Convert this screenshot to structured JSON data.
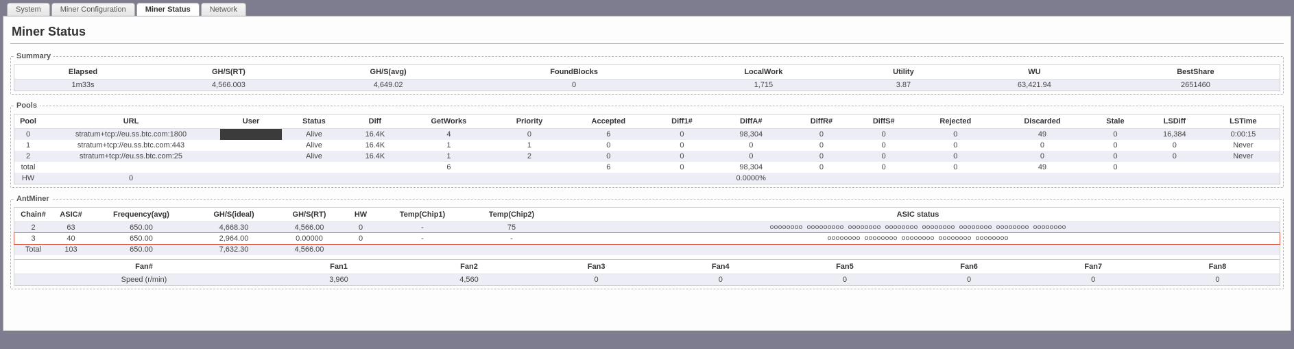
{
  "tabs": {
    "system": "System",
    "miner_config": "Miner Configuration",
    "miner_status": "Miner Status",
    "network": "Network"
  },
  "page_title": "Miner Status",
  "summary": {
    "legend": "Summary",
    "headers": {
      "elapsed": "Elapsed",
      "ghs_rt": "GH/S(RT)",
      "ghs_avg": "GH/S(avg)",
      "found_blocks": "FoundBlocks",
      "local_work": "LocalWork",
      "utility": "Utility",
      "wu": "WU",
      "best_share": "BestShare"
    },
    "row": {
      "elapsed": "1m33s",
      "ghs_rt": "4,566.003",
      "ghs_avg": "4,649.02",
      "found_blocks": "0",
      "local_work": "1,715",
      "utility": "3.87",
      "wu": "63,421.94",
      "best_share": "2651460"
    }
  },
  "pools": {
    "legend": "Pools",
    "headers": {
      "pool": "Pool",
      "url": "URL",
      "user": "User",
      "status": "Status",
      "diff": "Diff",
      "getworks": "GetWorks",
      "priority": "Priority",
      "accepted": "Accepted",
      "diff1": "Diff1#",
      "diffa": "DiffA#",
      "diffr": "DiffR#",
      "diffs": "DiffS#",
      "rejected": "Rejected",
      "discarded": "Discarded",
      "stale": "Stale",
      "lsdiff": "LSDiff",
      "lstime": "LSTime"
    },
    "rows": [
      {
        "pool": "0",
        "url": "stratum+tcp://eu.ss.btc.com:1800",
        "user": "",
        "status": "Alive",
        "diff": "16.4K",
        "getworks": "4",
        "priority": "0",
        "accepted": "6",
        "diff1": "0",
        "diffa": "98,304",
        "diffr": "0",
        "diffs": "0",
        "rejected": "0",
        "discarded": "49",
        "stale": "0",
        "lsdiff": "16,384",
        "lstime": "0:00:15"
      },
      {
        "pool": "1",
        "url": "stratum+tcp://eu.ss.btc.com:443",
        "user": "",
        "status": "Alive",
        "diff": "16.4K",
        "getworks": "1",
        "priority": "1",
        "accepted": "0",
        "diff1": "0",
        "diffa": "0",
        "diffr": "0",
        "diffs": "0",
        "rejected": "0",
        "discarded": "0",
        "stale": "0",
        "lsdiff": "0",
        "lstime": "Never"
      },
      {
        "pool": "2",
        "url": "stratum+tcp://eu.ss.btc.com:25",
        "user": "",
        "status": "Alive",
        "diff": "16.4K",
        "getworks": "1",
        "priority": "2",
        "accepted": "0",
        "diff1": "0",
        "diffa": "0",
        "diffr": "0",
        "diffs": "0",
        "rejected": "0",
        "discarded": "0",
        "stale": "0",
        "lsdiff": "0",
        "lstime": "Never"
      },
      {
        "pool": "total",
        "url": "",
        "user": "",
        "status": "",
        "diff": "",
        "getworks": "6",
        "priority": "",
        "accepted": "6",
        "diff1": "0",
        "diffa": "98,304",
        "diffr": "0",
        "diffs": "0",
        "rejected": "0",
        "discarded": "49",
        "stale": "0",
        "lsdiff": "",
        "lstime": ""
      },
      {
        "pool": "HW",
        "url": "0",
        "user": "",
        "status": "",
        "diff": "",
        "getworks": "",
        "priority": "",
        "accepted": "",
        "diff1": "",
        "diffa": "0.0000%",
        "diffr": "",
        "diffs": "",
        "rejected": "",
        "discarded": "",
        "stale": "",
        "lsdiff": "",
        "lstime": ""
      }
    ]
  },
  "antminer": {
    "legend": "AntMiner",
    "headers": {
      "chain": "Chain#",
      "asic": "ASIC#",
      "freq": "Frequency(avg)",
      "ghs_ideal": "GH/S(ideal)",
      "ghs_rt": "GH/S(RT)",
      "hw": "HW",
      "temp1": "Temp(Chip1)",
      "temp2": "Temp(Chip2)",
      "asic_status": "ASIC status"
    },
    "rows": [
      {
        "chain": "2",
        "asic": "63",
        "freq": "650.00",
        "ghs_ideal": "4,668.30",
        "ghs_rt": "4,566.00",
        "hw": "0",
        "temp1": "-",
        "temp2": "75",
        "asic_status": "oooooooo ooooooooo oooooooo oooooooo oooooooo oooooooo oooooooo oooooooo",
        "hl": false
      },
      {
        "chain": "3",
        "asic": "40",
        "freq": "650.00",
        "ghs_ideal": "2,964.00",
        "ghs_rt": "0.00000",
        "hw": "0",
        "temp1": "-",
        "temp2": "-",
        "asic_status": "oooooooo oooooooo oooooooo oooooooo oooooooo",
        "hl": true
      },
      {
        "chain": "Total",
        "asic": "103",
        "freq": "650.00",
        "ghs_ideal": "7,632.30",
        "ghs_rt": "4,566.00",
        "hw": "",
        "temp1": "",
        "temp2": "",
        "asic_status": "",
        "hl": false
      }
    ],
    "fan_headers": {
      "fan_num": "Fan#",
      "fan1": "Fan1",
      "fan2": "Fan2",
      "fan3": "Fan3",
      "fan4": "Fan4",
      "fan5": "Fan5",
      "fan6": "Fan6",
      "fan7": "Fan7",
      "fan8": "Fan8"
    },
    "fan_row": {
      "label": "Speed (r/min)",
      "fan1": "3,960",
      "fan2": "4,560",
      "fan3": "0",
      "fan4": "0",
      "fan5": "0",
      "fan6": "0",
      "fan7": "0",
      "fan8": "0"
    }
  }
}
